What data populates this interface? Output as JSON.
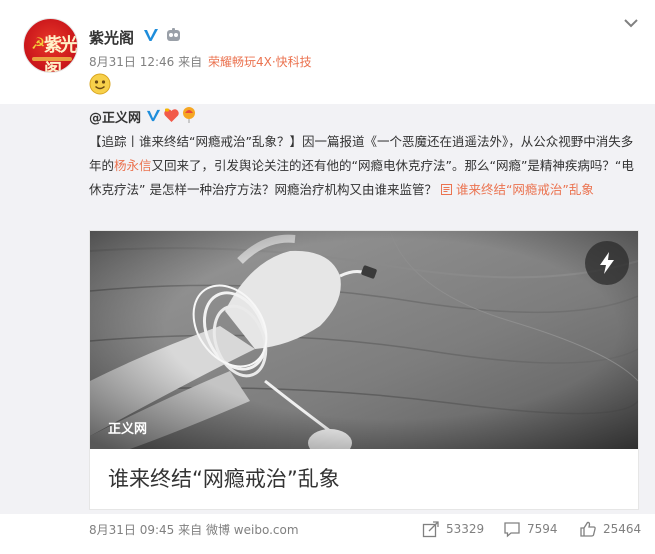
{
  "post": {
    "author": {
      "name": "紫光阁",
      "avatar_text": "紫光阁"
    },
    "time": "8月31日 12:46",
    "from_label": "来自",
    "source": "荣耀畅玩4X·快科技",
    "emoji": "slightly-smiling-face"
  },
  "repost": {
    "author_mention": "@正义网",
    "text_parts": {
      "p1": "【追踪丨谁来终结“网瘾戒治”乱象？】因一篇报道《一个恶魔还在逍遥法外》，从公众视野中消失多年的",
      "name_highlight": "杨永信",
      "p2": "又回来了，引发舆论关注的还有他的“网瘾电休克疗法”。那么“网瘾”是精神疾病吗？“电休克疗法” 是怎样一种治疗方法？网瘾治疗机构又由谁来监管？ ",
      "link_text": "谁来终结“网瘾戒治”乱象"
    },
    "card": {
      "watermark": "正义网",
      "title": "谁来终结“网瘾戒治”乱象"
    },
    "time": "8月31日 09:45",
    "from_label": "来自",
    "source": "微博 weibo.com",
    "stats": {
      "shares": "53329",
      "comments": "7594",
      "likes": "25464"
    }
  },
  "colors": {
    "accent": "#eb7350",
    "verified_blue": "#1e8ddb",
    "repost_bg": "#f2f2f5"
  }
}
